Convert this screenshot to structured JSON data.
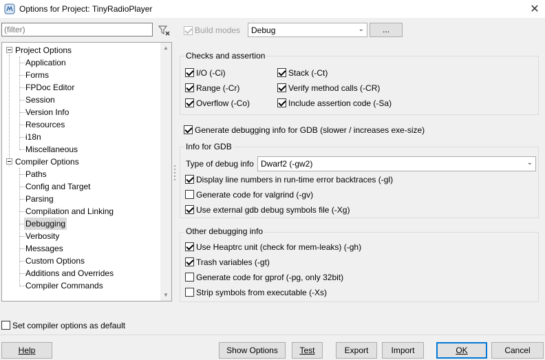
{
  "window": {
    "title": "Options for Project: TinyRadioPlayer",
    "app_icon": "lazarus-icon",
    "close_glyph": "✕"
  },
  "filter": {
    "placeholder": "(filter)",
    "value": ""
  },
  "tree": {
    "groups": [
      {
        "label": "Project Options",
        "items": [
          "Application",
          "Forms",
          "FPDoc Editor",
          "Session",
          "Version Info",
          "Resources",
          "i18n",
          "Miscellaneous"
        ]
      },
      {
        "label": "Compiler Options",
        "items": [
          "Paths",
          "Config and Target",
          "Parsing",
          "Compilation and Linking",
          "Debugging",
          "Verbosity",
          "Messages",
          "Custom Options",
          "Additions and Overrides",
          "Compiler Commands"
        ]
      }
    ],
    "selected": "Debugging"
  },
  "build_modes": {
    "label": "Build modes",
    "checked": true,
    "enabled": false,
    "value": "Debug",
    "dots_label": "..."
  },
  "checks": {
    "title": "Checks and assertion",
    "io": "I/O (-Ci)",
    "range": "Range (-Cr)",
    "overflow": "Overflow (-Co)",
    "stack": "Stack (-Ct)",
    "verify": "Verify method calls (-CR)",
    "assert": "Include assertion code (-Sa)"
  },
  "gdb_generate": {
    "label": "Generate debugging info for GDB (slower / increases exe-size)",
    "checked": true
  },
  "info_gdb": {
    "title": "Info for GDB",
    "type_label": "Type of debug info",
    "type_value": "Dwarf2 (-gw2)",
    "line_numbers": "Display line numbers in run-time error backtraces (-gl)",
    "valgrind": "Generate code for valgrind (-gv)",
    "external_symbols": "Use external gdb debug symbols file (-Xg)"
  },
  "other_debug": {
    "title": "Other debugging info",
    "heaptrc": "Use Heaptrc unit (check for mem-leaks) (-gh)",
    "trash": "Trash variables (-gt)",
    "gprof": "Generate code for gprof (-pg, only 32bit)",
    "strip": "Strip symbols from executable (-Xs)"
  },
  "default_checkbox": {
    "label": "Set compiler options as default",
    "checked": false
  },
  "buttons": {
    "help": "Help",
    "show_options": "Show Options",
    "test": "Test",
    "export": "Export",
    "import": "Import",
    "ok": "OK",
    "cancel": "Cancel"
  }
}
